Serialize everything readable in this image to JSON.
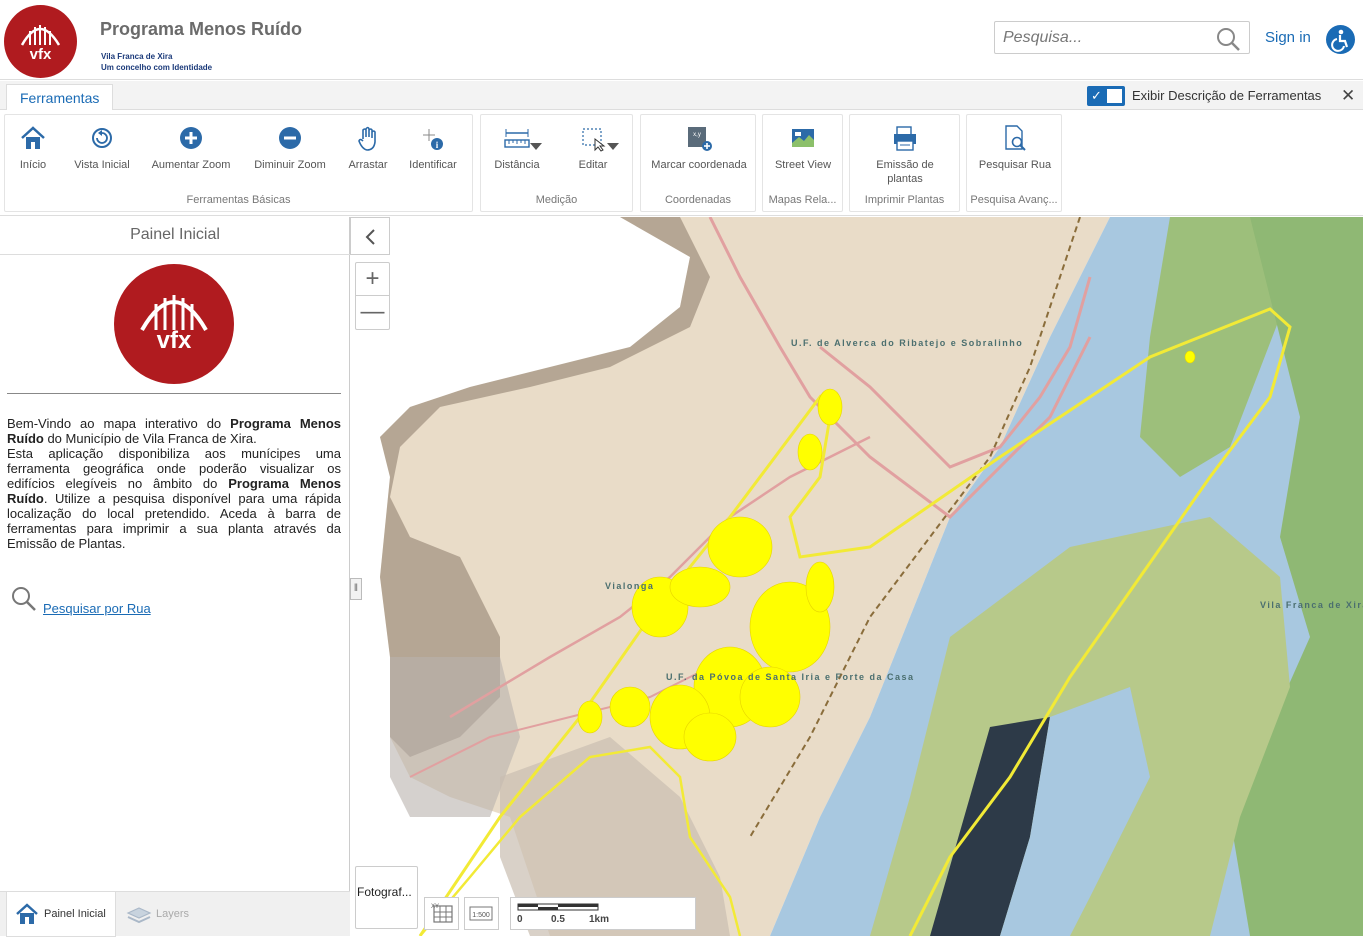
{
  "header": {
    "title": "Programa Menos Ruído",
    "subtitle_line1": "Vila Franca de Xira",
    "subtitle_line2": "Um concelho com Identidade",
    "logo_text": "vfx",
    "search_placeholder": "Pesquisa...",
    "signin_label": "Sign in"
  },
  "tabbar": {
    "tab_label": "Ferramentas",
    "toggle_label": "Exibir Descrição de Ferramentas",
    "close_glyph": "✕"
  },
  "ribbon": {
    "groups": [
      {
        "label": "Ferramentas Básicas",
        "tools": [
          "Início",
          "Vista Inicial",
          "Aumentar Zoom",
          "Diminuir Zoom",
          "Arrastar",
          "Identificar"
        ]
      },
      {
        "label": "Medição",
        "tools": [
          "Distância",
          "Editar"
        ]
      },
      {
        "label": "Coordenadas",
        "tools": [
          "Marcar coordenada"
        ]
      },
      {
        "label": "Mapas Rela...",
        "tools": [
          "Street View"
        ]
      },
      {
        "label": "Imprimir Plantas",
        "tools": [
          "Emissão de plantas"
        ]
      },
      {
        "label": "Pesquisa Avanç...",
        "tools": [
          "Pesquisar Rua"
        ]
      }
    ]
  },
  "panel": {
    "title": "Painel Inicial",
    "logo_text": "vfx",
    "intro_1": "Bem-Vindo ao mapa interativo do ",
    "intro_bold_1": "Programa Menos Ruído",
    "intro_2": " do Município de Vila Franca de Xira.",
    "intro_3": "Esta aplicação disponibiliza aos munícipes uma ferramenta geográfica onde poderão visualizar os edifícios elegíveis no âmbito do ",
    "intro_bold_2": "Programa Menos Ruído",
    "intro_4": ". Utilize a pesquisa disponível para uma rápida localização do local pretendido. Aceda à barra de ferramentas para imprimir a sua planta através da Emissão de Plantas.",
    "search_link": "Pesquisar por Rua",
    "tabs": {
      "home": "Painel Inicial",
      "layers": "Layers"
    }
  },
  "map": {
    "zoom_in": "+",
    "zoom_out": "—",
    "basemap_label": "Fotograf...",
    "scale_tool_label": "1:500",
    "scale_labels": [
      "0",
      "0.5",
      "1km"
    ],
    "place_labels": [
      "U.F. de Alverca do Ribatejo e Sobralinho",
      "Vialonga",
      "U.F. da Póvoa de Santa Iria e Forte da Casa",
      "Vila Franca de Xira"
    ]
  },
  "colors": {
    "brand_red": "#b01b1f",
    "accent_blue": "#1a6bb5",
    "highlight_yellow": "#ffff00",
    "river": "#a8c8e0",
    "green_land": "#9dbf7b"
  }
}
